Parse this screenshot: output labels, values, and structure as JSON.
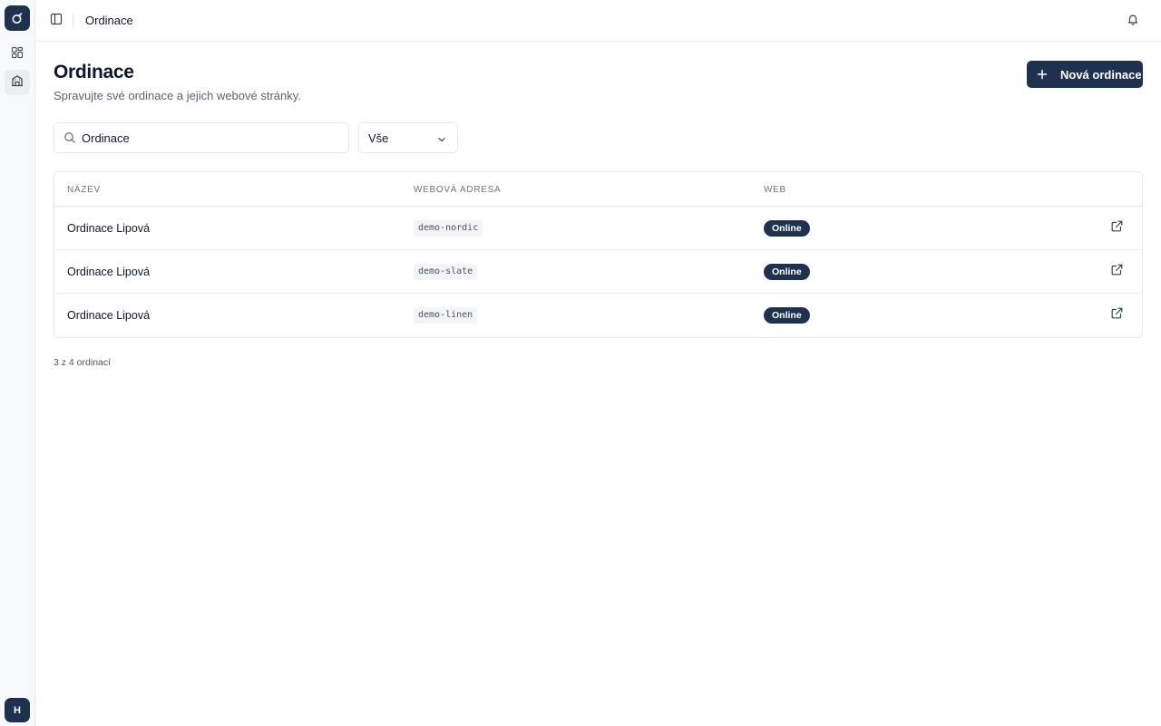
{
  "topbar": {
    "title": "Ordinace"
  },
  "header": {
    "title": "Ordinace",
    "subtitle": "Spravujte své ordinace a jejich webové stránky.",
    "new_button_label": "Nová ordinace"
  },
  "filters": {
    "search_value": "Ordinace",
    "status_selected": "Vše"
  },
  "table": {
    "columns": [
      "NÁZEV",
      "WEBOVÁ ADRESA",
      "WEB"
    ],
    "rows": [
      {
        "name": "Ordinace Lipová",
        "slug": "demo-nordic",
        "status": "Online"
      },
      {
        "name": "Ordinace Lipová",
        "slug": "demo-slate",
        "status": "Online"
      },
      {
        "name": "Ordinace Lipová",
        "slug": "demo-linen",
        "status": "Online"
      }
    ]
  },
  "footer": {
    "count_text": "3 z 4 ordinací"
  },
  "user": {
    "avatar_initial": "H"
  },
  "icons": {
    "logo": "logo-icon",
    "nav_dashboard": "grid-icon",
    "nav_clinics": "building-icon",
    "sidebar_toggle": "sidebar-toggle-icon",
    "notifications": "bell-icon",
    "search": "search-icon",
    "select": "chevron-down-icon",
    "row_action": "external-link-icon"
  },
  "colors": {
    "primary": "#1e3250",
    "border": "#e6e8ec",
    "muted_text": "#6b7280"
  }
}
